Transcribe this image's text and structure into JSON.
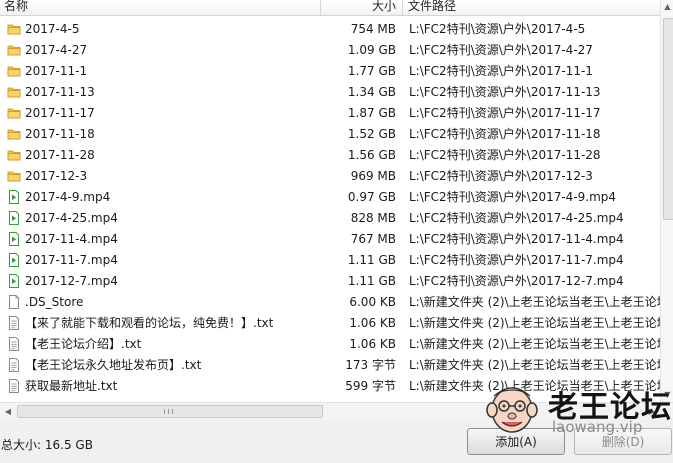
{
  "columns": {
    "name": "名称",
    "size": "大小",
    "path": "文件路径"
  },
  "files": [
    {
      "icon": "folder-icon",
      "name": "2017-4-5",
      "size": "754 MB",
      "path": "L:\\FC2特刊\\资源\\户外\\2017-4-5"
    },
    {
      "icon": "folder-icon",
      "name": "2017-4-27",
      "size": "1.09 GB",
      "path": "L:\\FC2特刊\\资源\\户外\\2017-4-27"
    },
    {
      "icon": "folder-icon",
      "name": "2017-11-1",
      "size": "1.77 GB",
      "path": "L:\\FC2特刊\\资源\\户外\\2017-11-1"
    },
    {
      "icon": "folder-icon",
      "name": "2017-11-13",
      "size": "1.34 GB",
      "path": "L:\\FC2特刊\\资源\\户外\\2017-11-13"
    },
    {
      "icon": "folder-icon",
      "name": "2017-11-17",
      "size": "1.87 GB",
      "path": "L:\\FC2特刊\\资源\\户外\\2017-11-17"
    },
    {
      "icon": "folder-icon",
      "name": "2017-11-18",
      "size": "1.52 GB",
      "path": "L:\\FC2特刊\\资源\\户外\\2017-11-18"
    },
    {
      "icon": "folder-icon",
      "name": "2017-11-28",
      "size": "1.56 GB",
      "path": "L:\\FC2特刊\\资源\\户外\\2017-11-28"
    },
    {
      "icon": "folder-icon",
      "name": "2017-12-3",
      "size": "969 MB",
      "path": "L:\\FC2特刊\\资源\\户外\\2017-12-3"
    },
    {
      "icon": "video-file-icon",
      "name": "2017-4-9.mp4",
      "size": "0.97 GB",
      "path": "L:\\FC2特刊\\资源\\户外\\2017-4-9.mp4"
    },
    {
      "icon": "video-file-icon",
      "name": "2017-4-25.mp4",
      "size": "828 MB",
      "path": "L:\\FC2特刊\\资源\\户外\\2017-4-25.mp4"
    },
    {
      "icon": "video-file-icon",
      "name": "2017-11-4.mp4",
      "size": "767 MB",
      "path": "L:\\FC2特刊\\资源\\户外\\2017-11-4.mp4"
    },
    {
      "icon": "video-file-icon",
      "name": "2017-11-7.mp4",
      "size": "1.11 GB",
      "path": "L:\\FC2特刊\\资源\\户外\\2017-11-7.mp4"
    },
    {
      "icon": "video-file-icon",
      "name": "2017-12-7.mp4",
      "size": "1.11 GB",
      "path": "L:\\FC2特刊\\资源\\户外\\2017-12-7.mp4"
    },
    {
      "icon": "blank-file-icon",
      "name": ".DS_Store",
      "size": "6.00 KB",
      "path": "L:\\新建文件夹 (2)\\上老王论坛当老王\\上老王论坛"
    },
    {
      "icon": "text-file-icon",
      "name": "【来了就能下载和观看的论坛，纯免费！】.txt",
      "size": "1.06 KB",
      "path": "L:\\新建文件夹 (2)\\上老王论坛当老王\\上老王论坛"
    },
    {
      "icon": "text-file-icon",
      "name": "【老王论坛介绍】.txt",
      "size": "1.06 KB",
      "path": "L:\\新建文件夹 (2)\\上老王论坛当老王\\上老王论坛"
    },
    {
      "icon": "text-file-icon",
      "name": "【老王论坛永久地址发布页】.txt",
      "size": "173 字节",
      "path": "L:\\新建文件夹 (2)\\上老王论坛当老王\\上老王论坛"
    },
    {
      "icon": "text-file-icon",
      "name": "获取最新地址.txt",
      "size": "599 字节",
      "path": "L:\\新建文件夹 (2)\\上老王论坛当老王\\上老王论坛"
    }
  ],
  "footer": {
    "total_label": "总大小: 16.5 GB"
  },
  "buttons": {
    "add": "添加(A)",
    "delete": "删除(D)"
  },
  "watermark": {
    "brand": "老王论坛",
    "domain": "laowang.vip"
  },
  "colors": {
    "folder": "#f2c34a",
    "video": "#3f9a3f",
    "list_bg": "#ffffff",
    "window_bg": "#f0f0f0"
  }
}
